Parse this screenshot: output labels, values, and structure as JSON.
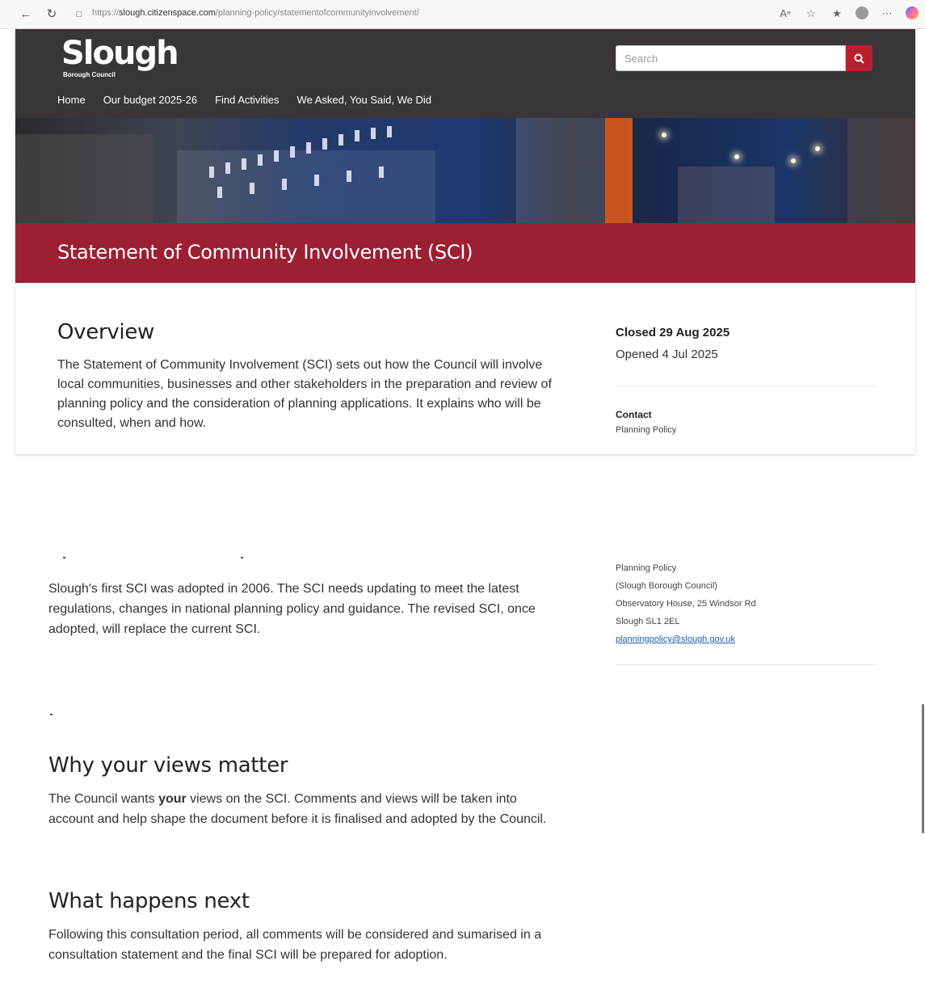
{
  "browser": {
    "url_prefix": "https://",
    "url_host": "slough.citizenspace.com",
    "url_path": "/planning-policy/statementofcommunityinvolvement/"
  },
  "header": {
    "logo_main": "Slough",
    "logo_sub": "Borough Council",
    "search_placeholder": "Search",
    "nav": [
      "Home",
      "Our budget 2025-26",
      "Find Activities",
      "We Asked, You Said, We Did"
    ]
  },
  "page": {
    "title": "Statement of Community Involvement (SCI)"
  },
  "overview": {
    "heading": "Overview",
    "paragraph": "The Statement of Community Involvement (SCI) sets out how the Council will involve local communities, businesses and other stakeholders in the preparation and review of planning policy and the consideration of planning applications. It explains who will be consulted, when and how.",
    "paragraph2": "Slough's first SCI was adopted in 2006. The SCI needs updating to meet the latest regulations, changes in national planning policy and guidance. The revised SCI, once adopted, will replace the current SCI."
  },
  "sidebar": {
    "closed": "Closed 29 Aug 2025",
    "opened": "Opened 4 Jul 2025",
    "contact_heading": "Contact",
    "contact_name_top": "Planning Policy",
    "contact_lines": [
      "Planning Policy",
      "(Slough Borough Council)",
      "Observatory House, 25 Windsor Rd",
      "Slough SL1 2EL"
    ],
    "contact_email": "planningpolicy@slough.gov.uk"
  },
  "why": {
    "heading": "Why your views matter",
    "pre": "The Council wants ",
    "bold": "your",
    "post": " views on the SCI. Comments and views will be taken into account and help shape the document before it is finalised and adopted by the Council."
  },
  "next": {
    "heading": "What happens next",
    "paragraph": "Following this consultation period, all comments will be considered and sumarised in a consultation statement  and the final SCI will be prepared for adoption."
  },
  "colors": {
    "header_bg": "#3a3539",
    "title_bar": "#9d1f33",
    "search_button": "#b8202e",
    "link": "#1a5fb4"
  }
}
